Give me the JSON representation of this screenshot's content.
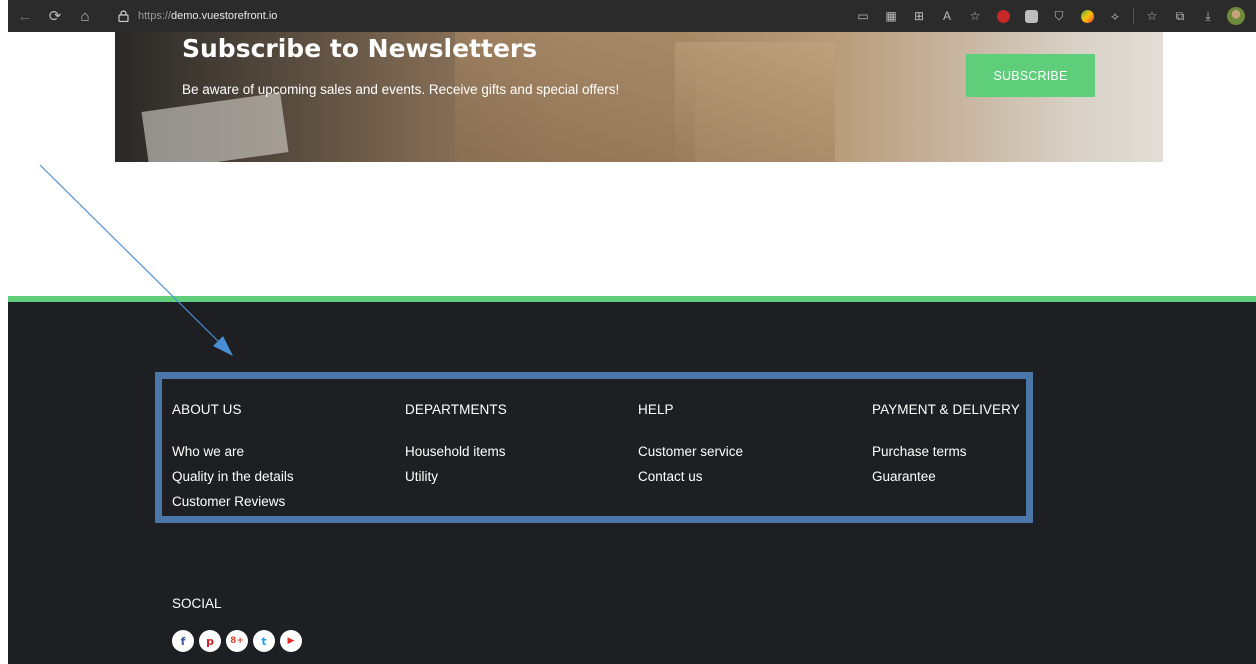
{
  "browser": {
    "url_prefix": "https://",
    "url_host": "demo.vuestorefront.io",
    "icons": [
      "back-icon",
      "refresh-icon",
      "home-icon",
      "lock-icon"
    ]
  },
  "newsletter": {
    "title": "Subscribe to Newsletters",
    "subtitle": "Be aware of upcoming sales and events. Receive gifts and special offers!",
    "button_label": "SUBSCRIBE"
  },
  "footer": {
    "accent_color": "#5ece7b",
    "highlight_color": "#4a76a8",
    "columns": [
      {
        "heading": "ABOUT US",
        "links": [
          "Who we are",
          "Quality in the details",
          "Customer Reviews"
        ]
      },
      {
        "heading": "DEPARTMENTS",
        "links": [
          "Household items",
          "Utility"
        ]
      },
      {
        "heading": "HELP",
        "links": [
          "Customer service",
          "Contact us"
        ]
      },
      {
        "heading": "PAYMENT & DELIVERY",
        "links": [
          "Purchase terms",
          "Guarantee"
        ]
      }
    ],
    "social": {
      "heading": "SOCIAL",
      "icons": [
        {
          "name": "facebook-icon",
          "glyph": "f",
          "color": "#3b5998"
        },
        {
          "name": "pinterest-icon",
          "glyph": "p",
          "color": "#cb2027"
        },
        {
          "name": "google-plus-icon",
          "glyph": "8+",
          "color": "#dd4b39"
        },
        {
          "name": "twitter-icon",
          "glyph": "t",
          "color": "#1da1f2"
        },
        {
          "name": "youtube-icon",
          "glyph": "▶",
          "color": "#e52d27"
        }
      ]
    }
  }
}
